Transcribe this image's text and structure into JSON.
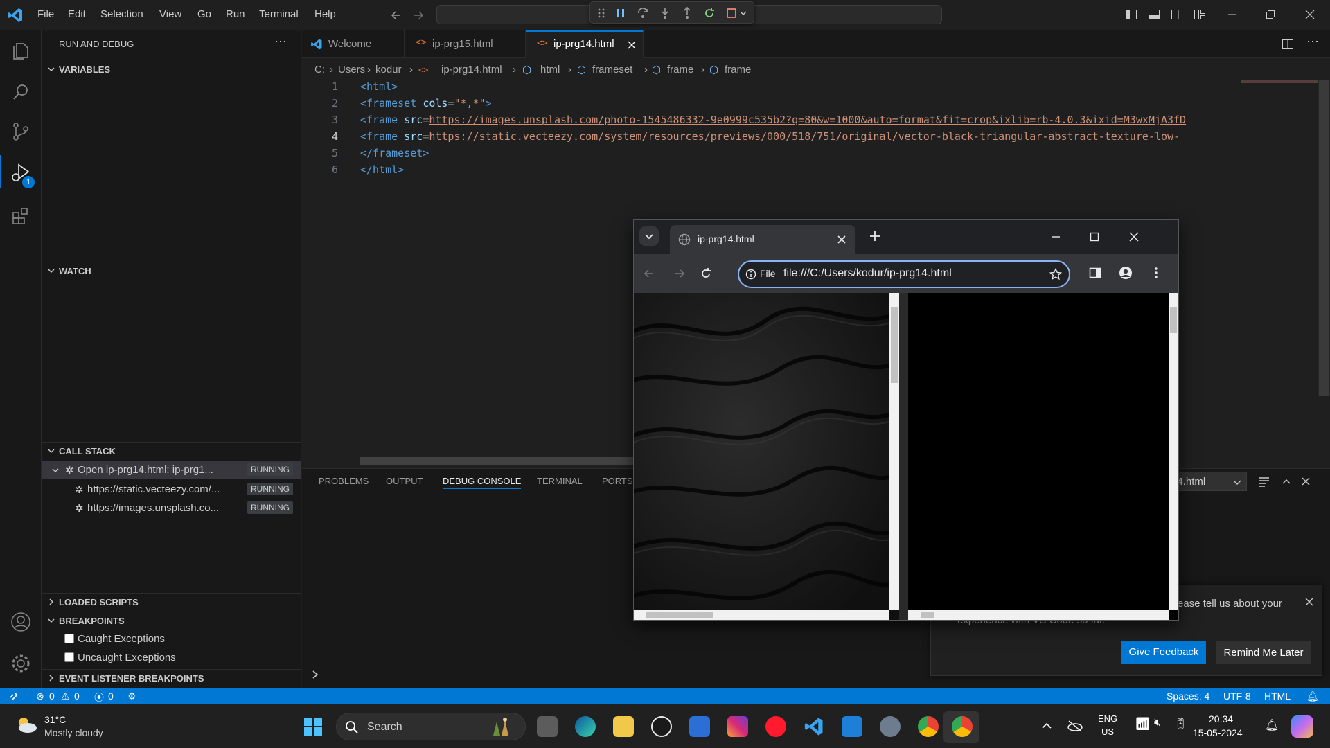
{
  "menu": [
    "File",
    "Edit",
    "Selection",
    "View",
    "Go",
    "Run",
    "Terminal",
    "Help"
  ],
  "sidebar": {
    "title": "RUN AND DEBUG",
    "sections": {
      "variables": "VARIABLES",
      "watch": "WATCH",
      "call_stack": "CALL STACK",
      "loaded_scripts": "LOADED SCRIPTS",
      "breakpoints": "BREAKPOINTS",
      "event_listener": "EVENT LISTENER BREAKPOINTS"
    },
    "call_stack_items": [
      {
        "label": "Open ip-prg14.html: ip-prg1...",
        "status": "RUNNING"
      },
      {
        "label": "https://static.vecteezy.com/...",
        "status": "RUNNING"
      },
      {
        "label": "https://images.unsplash.co...",
        "status": "RUNNING"
      }
    ],
    "breakpoints": [
      "Caught Exceptions",
      "Uncaught Exceptions"
    ],
    "debug_badge": "1"
  },
  "tabs": [
    {
      "label": "Welcome"
    },
    {
      "label": "ip-prg15.html"
    },
    {
      "label": "ip-prg14.html"
    }
  ],
  "breadcrumb": [
    "C:",
    "Users",
    "kodur",
    "ip-prg14.html",
    "html",
    "frameset",
    "frame",
    "frame"
  ],
  "code": {
    "line_numbers": [
      "1",
      "2",
      "3",
      "4",
      "5",
      "6"
    ],
    "l1": "<html>",
    "l2_tag": "<frameset",
    "l2_attr": "cols",
    "l2_val": "\"*,*\"",
    "l3_tag": "<frame",
    "l3_attr": "src",
    "l3_url": "https://images.unsplash.com/photo-1545486332-9e0999c535b2?q=80&w=1000&auto=format&fit=crop&ixlib=rb-4.0.3&ixid=M3wxMjA3fD",
    "l4_tag": "<frame",
    "l4_attr": "src",
    "l4_url": "https://static.vecteezy.com/system/resources/previews/000/518/751/original/vector-black-triangular-abstract-texture-low-",
    "l5": "</frameset>",
    "l6": "</html>"
  },
  "panel": {
    "tabs": [
      "PROBLEMS",
      "OUTPUT",
      "DEBUG CONSOLE",
      "TERMINAL",
      "PORTS"
    ],
    "dropdown": "14.html"
  },
  "toast": {
    "message_line1": "ease tell us about your",
    "message_line2": "experience with VS Code so far.",
    "give_feedback": "Give Feedback",
    "remind_later": "Remind Me Later"
  },
  "browser": {
    "tab_title": "ip-prg14.html",
    "chip": "File",
    "url": "file:///C:/Users/kodur/ip-prg14.html"
  },
  "statusbar": {
    "errors": "0",
    "warnings": "0",
    "ports": "0",
    "spaces": "Spaces: 4",
    "encoding": "UTF-8",
    "language": "HTML"
  },
  "taskbar": {
    "temp": "31°C",
    "weather": "Mostly cloudy",
    "search": "Search",
    "lang1": "ENG",
    "lang2": "US",
    "time": "20:34",
    "date": "15-05-2024"
  },
  "colors": {
    "accent": "#0078d4",
    "statusbar": "#0078d4",
    "tag": "#569cd6",
    "attr": "#9cdcfe",
    "string": "#ce9178"
  }
}
